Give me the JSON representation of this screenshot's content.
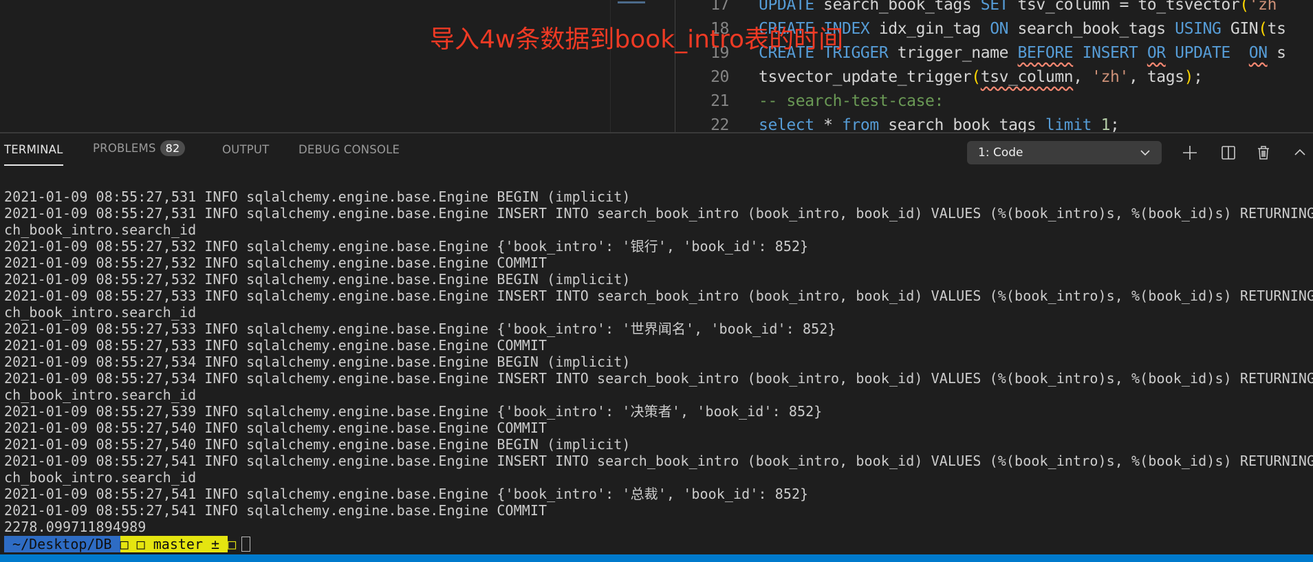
{
  "editor": {
    "lines": [
      {
        "num": "17",
        "tokens": [
          [
            "UPDATE",
            "kw"
          ],
          [
            " search_book_tags ",
            "tx"
          ],
          [
            "SET",
            "kw"
          ],
          [
            " tsv_column = to_tsvector",
            "tx"
          ],
          [
            "(",
            "pn"
          ],
          [
            "'zh",
            "st"
          ]
        ]
      },
      {
        "num": "18",
        "tokens": [
          [
            "CREATE INDEX",
            "kw"
          ],
          [
            " idx_gin_tag ",
            "tx"
          ],
          [
            "ON",
            "kw"
          ],
          [
            " search_book_tags ",
            "tx"
          ],
          [
            "USING",
            "kw"
          ],
          [
            " GIN",
            "tx"
          ],
          [
            "(",
            "pn"
          ],
          [
            "ts",
            "tx"
          ]
        ]
      },
      {
        "num": "19",
        "tokens": [
          [
            "CREATE TRIGGER",
            "kw"
          ],
          [
            " trigger_name ",
            "tx"
          ],
          [
            "BEFORE",
            "kw sq"
          ],
          [
            " ",
            "tx"
          ],
          [
            "INSERT",
            "kw"
          ],
          [
            " ",
            "tx"
          ],
          [
            "OR",
            "kw sq"
          ],
          [
            " ",
            "tx"
          ],
          [
            "UPDATE",
            "kw"
          ],
          [
            "  ",
            "tx"
          ],
          [
            "ON",
            "kw sq"
          ],
          [
            " s",
            "tx"
          ]
        ]
      },
      {
        "num": "20",
        "tokens": [
          [
            "tsvector_update_trigger",
            "tx"
          ],
          [
            "(",
            "pn"
          ],
          [
            "tsv_column",
            "tx sq"
          ],
          [
            ", ",
            "tx"
          ],
          [
            "'zh'",
            "st"
          ],
          [
            ", tags",
            "tx"
          ],
          [
            ")",
            "pn"
          ],
          [
            ";",
            "tx"
          ]
        ]
      },
      {
        "num": "21",
        "tokens": [
          [
            "-- search-test-case:",
            "cm"
          ]
        ]
      },
      {
        "num": "22",
        "tokens": [
          [
            "select",
            "kw"
          ],
          [
            " * ",
            "tx"
          ],
          [
            "from",
            "kw"
          ],
          [
            " search_book_tags ",
            "tx"
          ],
          [
            "limit",
            "kw"
          ],
          [
            " ",
            "tx"
          ],
          [
            "1",
            "nm"
          ],
          [
            ";",
            "tx"
          ]
        ]
      }
    ]
  },
  "annotation": "导入4w条数据到book_intro表的时间",
  "panel": {
    "tabs": [
      {
        "label": "TERMINAL",
        "active": true
      },
      {
        "label": "PROBLEMS",
        "badge": "82"
      },
      {
        "label": "OUTPUT"
      },
      {
        "label": "DEBUG CONSOLE"
      }
    ],
    "terminal_select": "1: Code",
    "actions": [
      "plus-icon",
      "split-icon",
      "trash-icon",
      "chevron-up-icon"
    ]
  },
  "terminal": {
    "lines": [
      "2021-01-09 08:55:27,531 INFO sqlalchemy.engine.base.Engine BEGIN (implicit)",
      "2021-01-09 08:55:27,531 INFO sqlalchemy.engine.base.Engine INSERT INTO search_book_intro (book_intro, book_id) VALUES (%(book_intro)s, %(book_id)s) RETURNING sear",
      "ch_book_intro.search_id",
      "2021-01-09 08:55:27,532 INFO sqlalchemy.engine.base.Engine {'book_intro': '银行', 'book_id': 852}",
      "2021-01-09 08:55:27,532 INFO sqlalchemy.engine.base.Engine COMMIT",
      "2021-01-09 08:55:27,532 INFO sqlalchemy.engine.base.Engine BEGIN (implicit)",
      "2021-01-09 08:55:27,533 INFO sqlalchemy.engine.base.Engine INSERT INTO search_book_intro (book_intro, book_id) VALUES (%(book_intro)s, %(book_id)s) RETURNING sear",
      "ch_book_intro.search_id",
      "2021-01-09 08:55:27,533 INFO sqlalchemy.engine.base.Engine {'book_intro': '世界闻名', 'book_id': 852}",
      "2021-01-09 08:55:27,533 INFO sqlalchemy.engine.base.Engine COMMIT",
      "2021-01-09 08:55:27,534 INFO sqlalchemy.engine.base.Engine BEGIN (implicit)",
      "2021-01-09 08:55:27,534 INFO sqlalchemy.engine.base.Engine INSERT INTO search_book_intro (book_intro, book_id) VALUES (%(book_intro)s, %(book_id)s) RETURNING sear",
      "ch_book_intro.search_id",
      "2021-01-09 08:55:27,539 INFO sqlalchemy.engine.base.Engine {'book_intro': '决策者', 'book_id': 852}",
      "2021-01-09 08:55:27,540 INFO sqlalchemy.engine.base.Engine COMMIT",
      "2021-01-09 08:55:27,540 INFO sqlalchemy.engine.base.Engine BEGIN (implicit)",
      "2021-01-09 08:55:27,541 INFO sqlalchemy.engine.base.Engine INSERT INTO search_book_intro (book_intro, book_id) VALUES (%(book_intro)s, %(book_id)s) RETURNING sear",
      "ch_book_intro.search_id",
      "2021-01-09 08:55:27,541 INFO sqlalchemy.engine.base.Engine {'book_intro': '总裁', 'book_id': 852}",
      "2021-01-09 08:55:27,541 INFO sqlalchemy.engine.base.Engine COMMIT",
      "2278.099711894989"
    ],
    "prompt": {
      "path": " ~/Desktop/DB ",
      "git": "□ □ master ± ",
      "tail": "□"
    }
  },
  "colors": {
    "status_bar": "#007acc",
    "prompt_path_bg": "#2e6cc4",
    "prompt_git_bg": "#e5e510",
    "annotation": "#ee3a24"
  }
}
